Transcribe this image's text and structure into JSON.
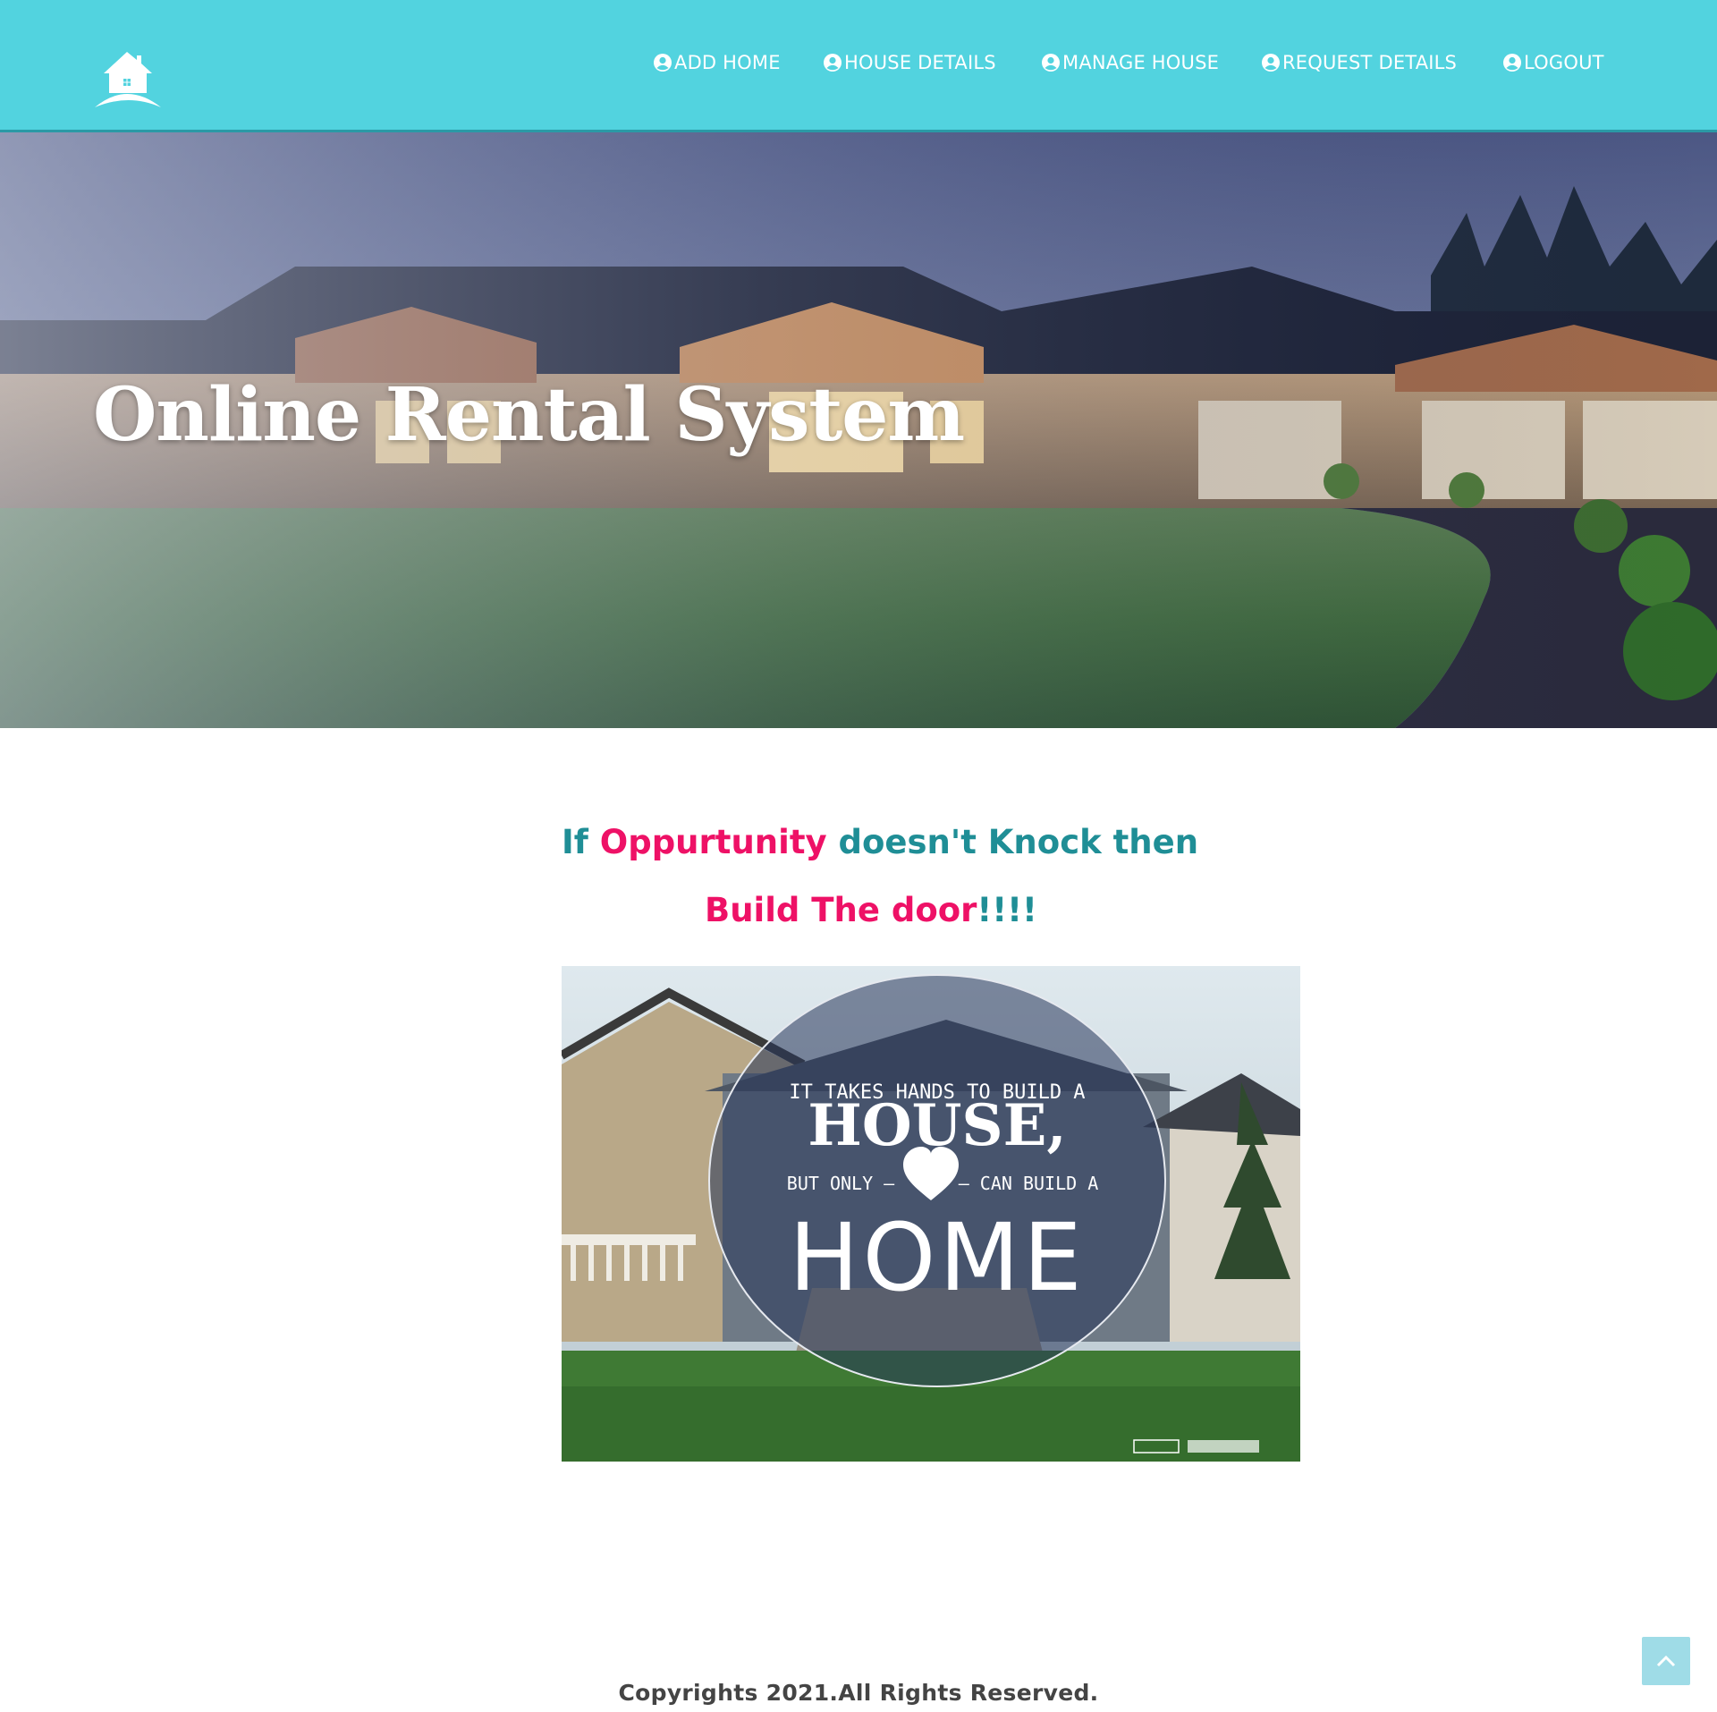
{
  "header": {
    "logo_icon": "house-logo-icon",
    "background_color": "#52d3df",
    "nav": [
      {
        "label": "ADD HOME",
        "icon": "user-circle-icon"
      },
      {
        "label": "HOUSE DETAILS",
        "icon": "user-circle-icon"
      },
      {
        "label": "MANAGE HOUSE",
        "icon": "user-circle-icon"
      },
      {
        "label": "REQUEST DETAILS",
        "icon": "user-circle-icon"
      },
      {
        "label": "LOGOUT",
        "icon": "user-circle-icon"
      }
    ]
  },
  "hero": {
    "title": "Online Rental System"
  },
  "quote": {
    "line1_part1": "If ",
    "line1_part2": "Oppurtunity",
    "line1_part3": " doesn't Knock then",
    "line2_part1": "Build The door",
    "line2_part2": "!!!!",
    "colors": {
      "teal": "#1f8e96",
      "pink": "#ee1166"
    }
  },
  "poster": {
    "line1": "IT TAKES HANDS TO BUILD A",
    "line2": "HOUSE,",
    "line3_left": "BUT ONLY —",
    "line3_right": "— CAN BUILD A",
    "line4": "HOME"
  },
  "footer": {
    "copyright": "Copyrights 2021.All Rights Reserved."
  },
  "scroll_top": {
    "icon": "chevron-up-icon"
  }
}
